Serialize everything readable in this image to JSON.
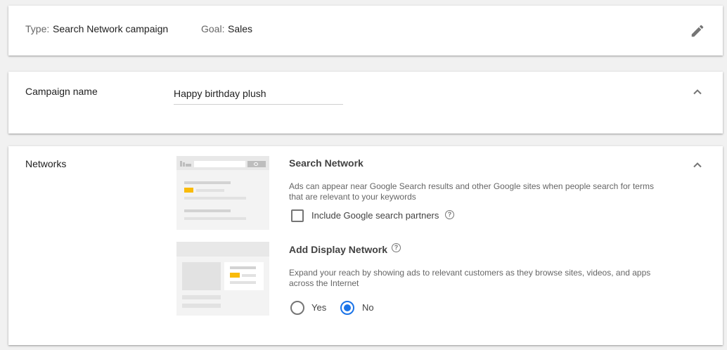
{
  "summary": {
    "type_label": "Type:",
    "type_value": "Search Network campaign",
    "goal_label": "Goal:",
    "goal_value": "Sales",
    "edit_icon": "pencil-icon"
  },
  "campaign_name": {
    "label": "Campaign name",
    "value": "Happy birthday plush",
    "collapse_icon": "chevron-up-icon"
  },
  "networks": {
    "label": "Networks",
    "collapse_icon": "chevron-up-icon",
    "search_network": {
      "title": "Search Network",
      "description": "Ads can appear near Google Search results and other Google sites when people search for terms that are relevant to your keywords",
      "partners_label": "Include Google search partners",
      "partners_checked": false
    },
    "display_network": {
      "title": "Add Display Network",
      "description": "Expand your reach by showing ads to relevant customers as they browse sites, videos, and apps across the Internet",
      "options": [
        "Yes",
        "No"
      ],
      "selected": "No"
    }
  },
  "colors": {
    "accent": "#1a73e8",
    "ad_highlight": "#f9bb0a"
  }
}
